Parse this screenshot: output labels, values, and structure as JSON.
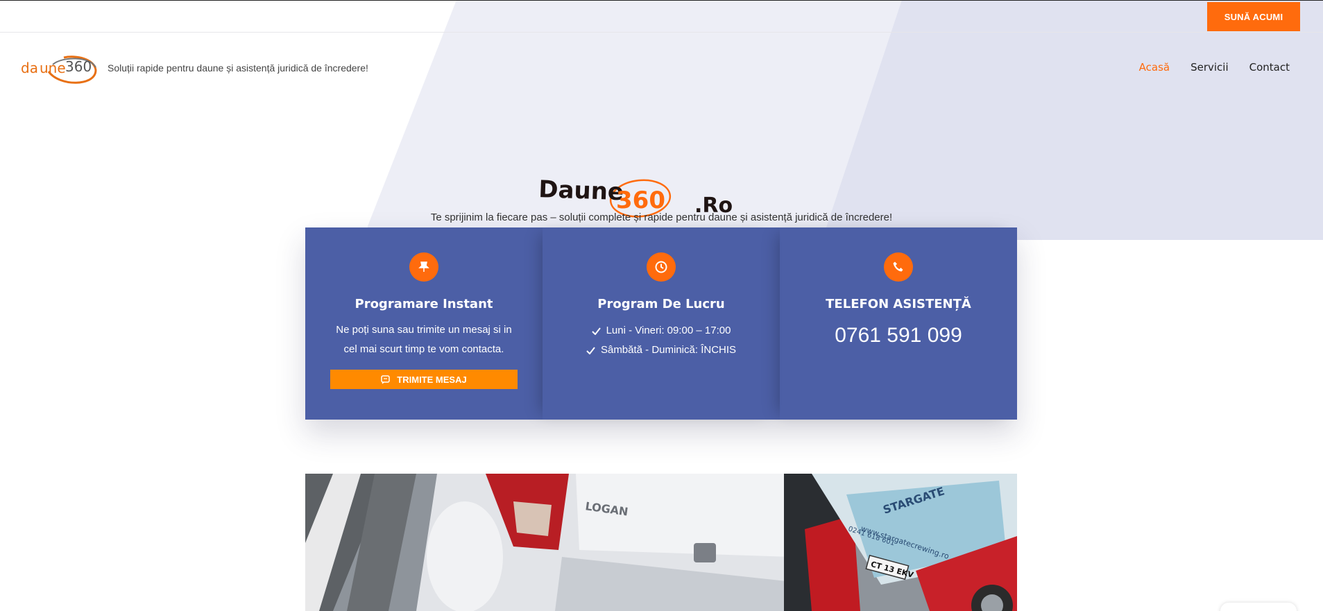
{
  "topbar": {
    "call_button": "SUNĂ ACUMI"
  },
  "header": {
    "logo_alt": "daune360",
    "tagline": "Soluții rapide pentru daune și asistență juridică de încredere!",
    "nav": [
      {
        "label": "Acasă",
        "active": true
      },
      {
        "label": "Servicii",
        "active": false
      },
      {
        "label": "Contact",
        "active": false
      }
    ]
  },
  "hero": {
    "logo_text_left": "Daune",
    "logo_text_mid": "360",
    "logo_text_right": ".Ro",
    "subtitle": "Te sprijinim la fiecare pas – soluții complete și rapide pentru daune și asistență juridică de încredere!"
  },
  "info": {
    "col1": {
      "icon": "pin-icon",
      "title": "Programare Instant",
      "text": "Ne poți suna sau trimite un mesaj si in cel mai scurt timp te vom contacta.",
      "button": "TRIMITE MESAJ"
    },
    "col2": {
      "icon": "clock-icon",
      "title": "Program De Lucru",
      "hours": [
        "Luni - Vineri: 09:00 – 17:00",
        "Sâmbătă - Duminică: ÎNCHIS"
      ]
    },
    "col3": {
      "icon": "phone-icon",
      "title": "TELEFON ASISTENȚĂ",
      "phone": "0761 591 099"
    }
  },
  "photo": {
    "car_badge": "LOGAN",
    "bus_brand": "STARGATE",
    "bus_site": "www.stargatecrewing.ro",
    "bus_phone": "0241 618 601",
    "plate": "CT 13 EKV"
  },
  "colors": {
    "accent": "#ff6b0d",
    "panel": "#4c5fa6"
  }
}
